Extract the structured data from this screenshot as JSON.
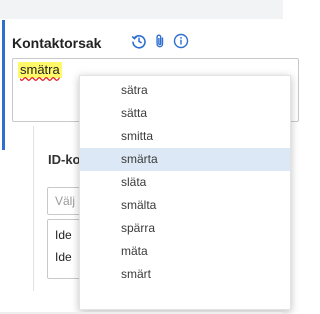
{
  "field": {
    "title": "Kontaktorsak",
    "icons": [
      "history-icon",
      "attachment-icon",
      "info-icon"
    ],
    "value": "smätra",
    "value_highlight_color": "#fff86a",
    "spellcheck_color": "#e0261f"
  },
  "section": {
    "title": "ID-ko",
    "select_placeholder": "Välj",
    "items": [
      "Ide",
      "Ide"
    ]
  },
  "suggestions": {
    "items": [
      "sätra",
      "sätta",
      "smitta",
      "smärta",
      "släta",
      "smälta",
      "spärra",
      "mäta",
      "smärt"
    ],
    "selected_index": 3,
    "selected_color": "#dce8f5"
  },
  "accent_color": "#2f6fd0"
}
